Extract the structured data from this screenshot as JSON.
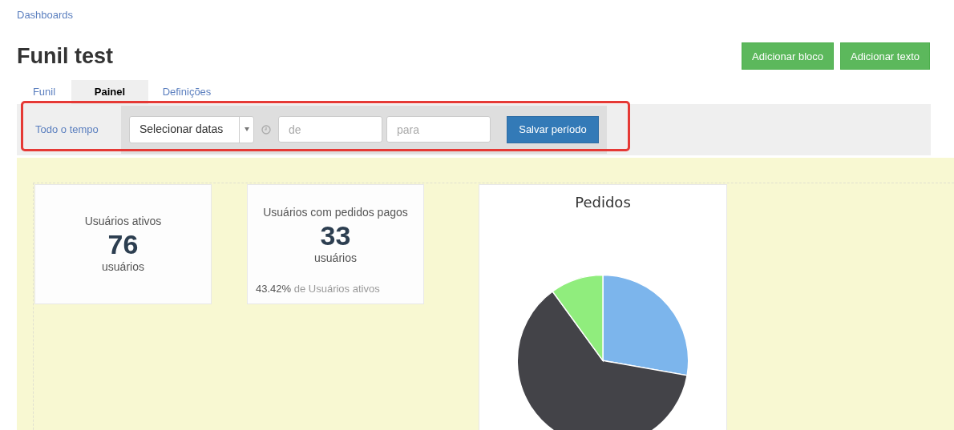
{
  "breadcrumb": "Dashboards",
  "title": "Funil test",
  "actions": [
    "Adicionar bloco",
    "Adicionar texto"
  ],
  "tabs": [
    {
      "label": "Funil",
      "selected": false
    },
    {
      "label": "Painel",
      "selected": true
    },
    {
      "label": "Definições",
      "selected": false
    }
  ],
  "filter": {
    "period_label": "Todo o tempo",
    "date_select": "Selecionar datas",
    "from": {
      "placeholder": "de"
    },
    "to": {
      "placeholder": "para"
    },
    "save": "Salvar período"
  },
  "cards": [
    {
      "kind": "metric",
      "label": "Usuários ativos",
      "value": "76",
      "unit": "usuários"
    },
    {
      "kind": "metric",
      "label": "Usuários com pedidos pagos",
      "value": "33",
      "unit": "usuários",
      "footnote_value": "43.42%",
      "footnote_text": "de Usuários ativos"
    },
    {
      "kind": "pie",
      "title": "Pedidos"
    }
  ]
}
